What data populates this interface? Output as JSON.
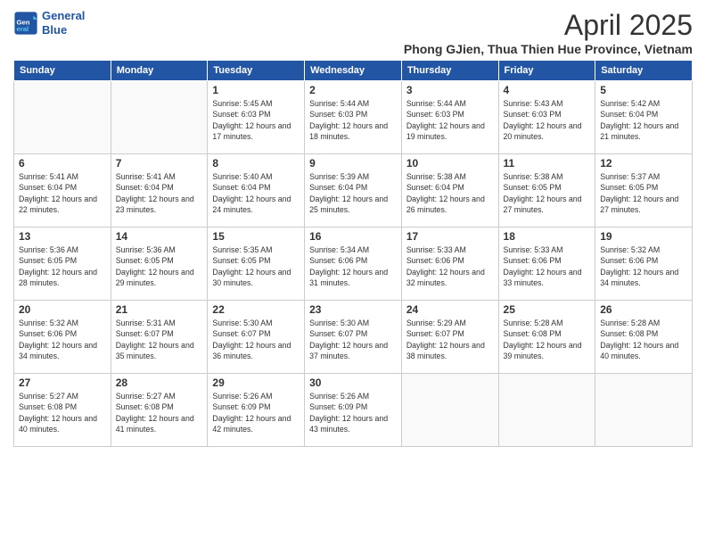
{
  "logo": {
    "line1": "General",
    "line2": "Blue"
  },
  "title": "April 2025",
  "subtitle": "Phong GJien, Thua Thien Hue Province, Vietnam",
  "days_of_week": [
    "Sunday",
    "Monday",
    "Tuesday",
    "Wednesday",
    "Thursday",
    "Friday",
    "Saturday"
  ],
  "weeks": [
    [
      {
        "num": "",
        "empty": true
      },
      {
        "num": "",
        "empty": true
      },
      {
        "num": "1",
        "rise": "5:45 AM",
        "set": "6:03 PM",
        "daylight": "12 hours and 17 minutes."
      },
      {
        "num": "2",
        "rise": "5:44 AM",
        "set": "6:03 PM",
        "daylight": "12 hours and 18 minutes."
      },
      {
        "num": "3",
        "rise": "5:44 AM",
        "set": "6:03 PM",
        "daylight": "12 hours and 19 minutes."
      },
      {
        "num": "4",
        "rise": "5:43 AM",
        "set": "6:03 PM",
        "daylight": "12 hours and 20 minutes."
      },
      {
        "num": "5",
        "rise": "5:42 AM",
        "set": "6:04 PM",
        "daylight": "12 hours and 21 minutes."
      }
    ],
    [
      {
        "num": "6",
        "rise": "5:41 AM",
        "set": "6:04 PM",
        "daylight": "12 hours and 22 minutes."
      },
      {
        "num": "7",
        "rise": "5:41 AM",
        "set": "6:04 PM",
        "daylight": "12 hours and 23 minutes."
      },
      {
        "num": "8",
        "rise": "5:40 AM",
        "set": "6:04 PM",
        "daylight": "12 hours and 24 minutes."
      },
      {
        "num": "9",
        "rise": "5:39 AM",
        "set": "6:04 PM",
        "daylight": "12 hours and 25 minutes."
      },
      {
        "num": "10",
        "rise": "5:38 AM",
        "set": "6:04 PM",
        "daylight": "12 hours and 26 minutes."
      },
      {
        "num": "11",
        "rise": "5:38 AM",
        "set": "6:05 PM",
        "daylight": "12 hours and 27 minutes."
      },
      {
        "num": "12",
        "rise": "5:37 AM",
        "set": "6:05 PM",
        "daylight": "12 hours and 27 minutes."
      }
    ],
    [
      {
        "num": "13",
        "rise": "5:36 AM",
        "set": "6:05 PM",
        "daylight": "12 hours and 28 minutes."
      },
      {
        "num": "14",
        "rise": "5:36 AM",
        "set": "6:05 PM",
        "daylight": "12 hours and 29 minutes."
      },
      {
        "num": "15",
        "rise": "5:35 AM",
        "set": "6:05 PM",
        "daylight": "12 hours and 30 minutes."
      },
      {
        "num": "16",
        "rise": "5:34 AM",
        "set": "6:06 PM",
        "daylight": "12 hours and 31 minutes."
      },
      {
        "num": "17",
        "rise": "5:33 AM",
        "set": "6:06 PM",
        "daylight": "12 hours and 32 minutes."
      },
      {
        "num": "18",
        "rise": "5:33 AM",
        "set": "6:06 PM",
        "daylight": "12 hours and 33 minutes."
      },
      {
        "num": "19",
        "rise": "5:32 AM",
        "set": "6:06 PM",
        "daylight": "12 hours and 34 minutes."
      }
    ],
    [
      {
        "num": "20",
        "rise": "5:32 AM",
        "set": "6:06 PM",
        "daylight": "12 hours and 34 minutes."
      },
      {
        "num": "21",
        "rise": "5:31 AM",
        "set": "6:07 PM",
        "daylight": "12 hours and 35 minutes."
      },
      {
        "num": "22",
        "rise": "5:30 AM",
        "set": "6:07 PM",
        "daylight": "12 hours and 36 minutes."
      },
      {
        "num": "23",
        "rise": "5:30 AM",
        "set": "6:07 PM",
        "daylight": "12 hours and 37 minutes."
      },
      {
        "num": "24",
        "rise": "5:29 AM",
        "set": "6:07 PM",
        "daylight": "12 hours and 38 minutes."
      },
      {
        "num": "25",
        "rise": "5:28 AM",
        "set": "6:08 PM",
        "daylight": "12 hours and 39 minutes."
      },
      {
        "num": "26",
        "rise": "5:28 AM",
        "set": "6:08 PM",
        "daylight": "12 hours and 40 minutes."
      }
    ],
    [
      {
        "num": "27",
        "rise": "5:27 AM",
        "set": "6:08 PM",
        "daylight": "12 hours and 40 minutes."
      },
      {
        "num": "28",
        "rise": "5:27 AM",
        "set": "6:08 PM",
        "daylight": "12 hours and 41 minutes."
      },
      {
        "num": "29",
        "rise": "5:26 AM",
        "set": "6:09 PM",
        "daylight": "12 hours and 42 minutes."
      },
      {
        "num": "30",
        "rise": "5:26 AM",
        "set": "6:09 PM",
        "daylight": "12 hours and 43 minutes."
      },
      {
        "num": "",
        "empty": true
      },
      {
        "num": "",
        "empty": true
      },
      {
        "num": "",
        "empty": true
      }
    ]
  ],
  "labels": {
    "sunrise": "Sunrise:",
    "sunset": "Sunset:",
    "daylight": "Daylight:"
  }
}
